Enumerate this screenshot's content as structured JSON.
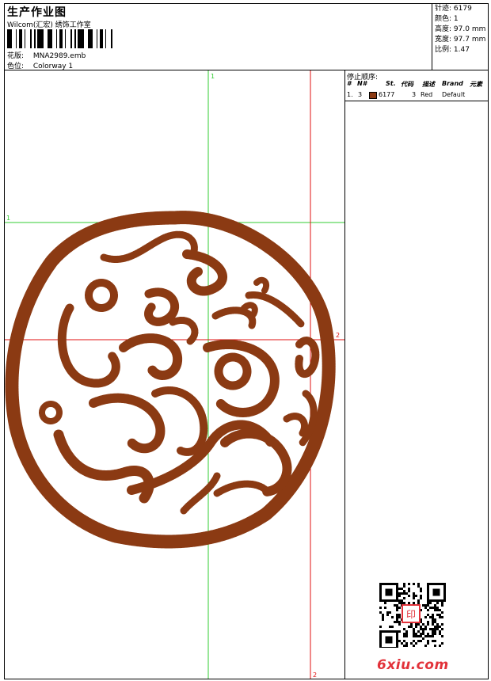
{
  "header": {
    "title": "生产作业图",
    "company": "Wilcom(汇宏) 绣饰工作室",
    "design_label": "花版:",
    "design_value": "MNA2989.emb",
    "colorway_label": "色位:",
    "colorway_value": "Colorway 1"
  },
  "stats": [
    {
      "label": "针迹:",
      "value": "6179"
    },
    {
      "label": "颜色:",
      "value": "1"
    },
    {
      "label": "高度:",
      "value": "97.0 mm"
    },
    {
      "label": "宽度:",
      "value": "97.7 mm"
    },
    {
      "label": "比例:",
      "value": "1.47"
    }
  ],
  "stop_sequence": {
    "title": "停止顺序:",
    "columns": [
      "#",
      "N#",
      "St.",
      "代码",
      "描述",
      "Brand",
      "元素"
    ],
    "rows": [
      {
        "index": "1.",
        "needle": "3",
        "stitches": "6177",
        "code": "3",
        "description": "Red",
        "brand": "Default",
        "color": "#8b3a13"
      }
    ]
  },
  "guides": {
    "h1": "1",
    "v1": "1",
    "h2": "2",
    "v2": "2",
    "green": "#33cc33",
    "red": "#e01010"
  },
  "design": {
    "thread_color": "#8b3a13"
  },
  "watermark": "6xiu.com",
  "qr_stamp_text": "印"
}
